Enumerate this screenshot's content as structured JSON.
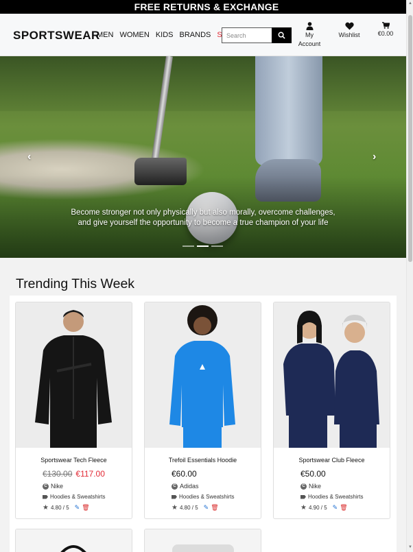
{
  "banner": {
    "text": "FREE RETURNS & EXCHANGE"
  },
  "header": {
    "logo": "SPORTSWEAR",
    "nav": [
      "MEN",
      "WOMEN",
      "KIDS",
      "BRANDS",
      "SALE"
    ],
    "search_placeholder": "Search",
    "account_label": "My Account",
    "wishlist_label": "Wishlist",
    "cart_label": "€0.00"
  },
  "hero": {
    "caption": "Become stronger not only physically but also morally, overcome challenges, and give yourself the opportunity to become a true champion of your life",
    "prev_icon": "chevron-left-icon",
    "next_icon": "chevron-right-icon",
    "slides": 3,
    "active_slide": 2
  },
  "trending": {
    "title": "Trending This Week",
    "products": [
      {
        "name": "Sportswear Tech Fleece",
        "old_price": "€130.00",
        "price": "€117.00",
        "on_sale": true,
        "brand": "Nike",
        "category": "Hoodies & Sweatshirts",
        "rating": "4.80 / 5"
      },
      {
        "name": "Trefoil Essentials Hoodie",
        "old_price": "",
        "price": "€60.00",
        "on_sale": false,
        "brand": "Adidas",
        "category": "Hoodies & Sweatshirts",
        "rating": "4.80 / 5"
      },
      {
        "name": "Sportswear Club Fleece",
        "old_price": "",
        "price": "€50.00",
        "on_sale": false,
        "brand": "Nike",
        "category": "Hoodies & Sweatshirts",
        "rating": "4.90 / 5"
      }
    ]
  },
  "colors": {
    "accent": "#e22a35",
    "banner": "#000000",
    "edit": "#1f6fd1",
    "delete": "#d92b2b"
  }
}
